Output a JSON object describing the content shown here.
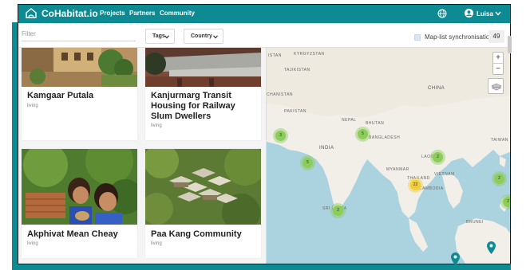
{
  "nav": {
    "brand": "CoHabitat.io",
    "links": [
      "Projects",
      "Partners",
      "Community"
    ],
    "user": "Luisa"
  },
  "filters": {
    "filter_placeholder": "Filter",
    "tags_label": "Tags",
    "country_label": "Country",
    "sync_label": "Map-list synchronisation",
    "count": "49"
  },
  "projects": [
    {
      "title": "Kamgaar Putala",
      "category": "living"
    },
    {
      "title": "Kanjurmarg Transit Housing for Railway Slum Dwellers",
      "category": "living"
    },
    {
      "title": "Akphivat Mean Cheay",
      "category": "living"
    },
    {
      "title": "Paa Kang Community",
      "category": "living"
    }
  ],
  "map": {
    "labels": [
      "ISTAN",
      "KYRGYZSTAN",
      "TAJIKISTAN",
      "CHANISTAN",
      "PAKISTAN",
      "NEPAL",
      "BHUTAN",
      "CHINA",
      "INDIA",
      "BANGLADESH",
      "TAIWAN",
      "LAOS",
      "MYANMAR",
      "THAILAND",
      "VIETNAM",
      "CAMBODIA",
      "SRI LANKA",
      "BRUNEI"
    ],
    "clusters": [
      "3",
      "5",
      "5",
      "2",
      "22",
      "2",
      "2",
      "2"
    ],
    "zoom_in": "+",
    "zoom_out": "−"
  },
  "colors": {
    "brand": "#0e8a93",
    "cluster_green": "#8ccc5a",
    "cluster_yellow": "#f2cd3a",
    "water": "#aad3df",
    "land": "#f2efe9"
  },
  "icons": {
    "logo": "house-hands-icon",
    "globe": "globe-icon",
    "user": "user-circle-icon",
    "layers": "layers-icon",
    "pin": "map-pin-icon"
  }
}
